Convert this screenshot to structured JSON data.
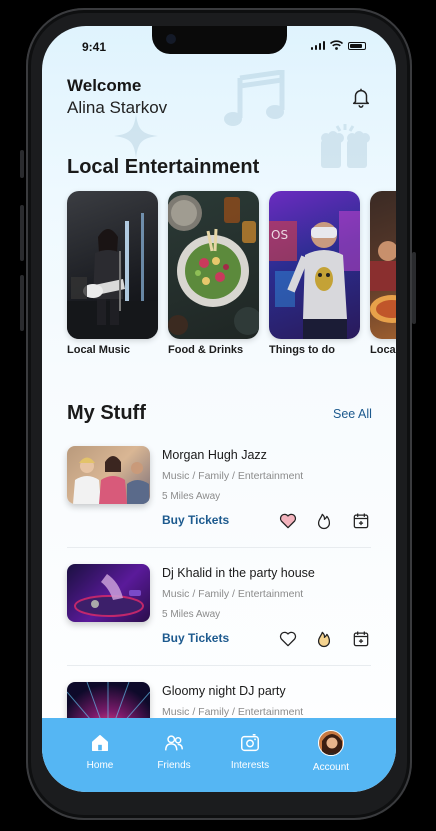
{
  "status_bar": {
    "time": "9:41"
  },
  "header": {
    "greeting": "Welcome",
    "user_name": "Alina Starkov"
  },
  "local_section": {
    "title": "Local Entertainment",
    "cards": [
      {
        "label": "Local Music"
      },
      {
        "label": "Food & Drinks"
      },
      {
        "label": "Things to do"
      },
      {
        "label": "Local"
      }
    ]
  },
  "my_stuff": {
    "title": "My Stuff",
    "see_all": "See All",
    "events": [
      {
        "title": "Morgan Hugh Jazz",
        "categories": "Music / Family / Entertainment",
        "distance": "5 Miles Away",
        "cta": "Buy Tickets",
        "liked": true,
        "hot": false
      },
      {
        "title": "Dj Khalid in the party house",
        "categories": "Music / Family / Entertainment",
        "distance": "5 Miles Away",
        "cta": "Buy Tickets",
        "liked": false,
        "hot": true
      },
      {
        "title": "Gloomy night DJ party",
        "categories": "Music / Family / Entertainment"
      }
    ]
  },
  "tabbar": {
    "tabs": [
      {
        "label": "Home",
        "icon": "home-icon",
        "active": true
      },
      {
        "label": "Friends",
        "icon": "friends-icon"
      },
      {
        "label": "Interests",
        "icon": "interests-icon"
      },
      {
        "label": "Account",
        "icon": "avatar"
      }
    ]
  },
  "colors": {
    "accent": "#55b6f3",
    "link": "#1d5a8e",
    "like_fill": "#f3b3bd",
    "hot_fill": "#f5d490",
    "background_top": "#dff3fd"
  }
}
